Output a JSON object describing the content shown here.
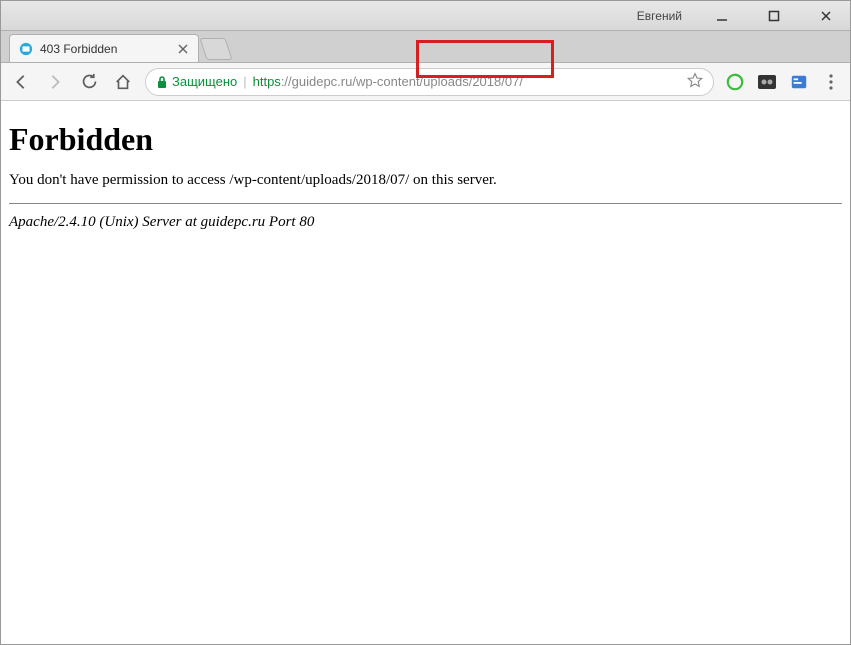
{
  "window": {
    "user": "Евгений"
  },
  "tab": {
    "title": "403 Forbidden"
  },
  "omnibox": {
    "secure_label": "Защищено",
    "divider": " | ",
    "scheme": "https",
    "url_rest": "://guidepc.ru/wp-content/uploads/2018/07/"
  },
  "page": {
    "heading": "Forbidden",
    "message": "You don't have permission to access /wp-content/uploads/2018/07/ on this server.",
    "server_signature": "Apache/2.4.10 (Unix) Server at guidepc.ru Port 80"
  }
}
